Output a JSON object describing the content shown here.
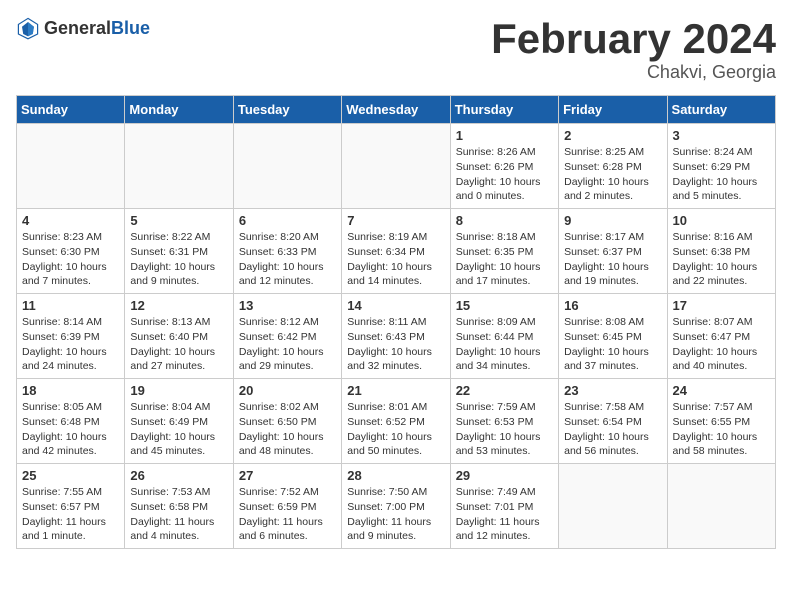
{
  "header": {
    "logo_general": "General",
    "logo_blue": "Blue",
    "month": "February 2024",
    "location": "Chakvi, Georgia"
  },
  "weekdays": [
    "Sunday",
    "Monday",
    "Tuesday",
    "Wednesday",
    "Thursday",
    "Friday",
    "Saturday"
  ],
  "weeks": [
    [
      {
        "day": "",
        "info": ""
      },
      {
        "day": "",
        "info": ""
      },
      {
        "day": "",
        "info": ""
      },
      {
        "day": "",
        "info": ""
      },
      {
        "day": "1",
        "info": "Sunrise: 8:26 AM\nSunset: 6:26 PM\nDaylight: 10 hours\nand 0 minutes."
      },
      {
        "day": "2",
        "info": "Sunrise: 8:25 AM\nSunset: 6:28 PM\nDaylight: 10 hours\nand 2 minutes."
      },
      {
        "day": "3",
        "info": "Sunrise: 8:24 AM\nSunset: 6:29 PM\nDaylight: 10 hours\nand 5 minutes."
      }
    ],
    [
      {
        "day": "4",
        "info": "Sunrise: 8:23 AM\nSunset: 6:30 PM\nDaylight: 10 hours\nand 7 minutes."
      },
      {
        "day": "5",
        "info": "Sunrise: 8:22 AM\nSunset: 6:31 PM\nDaylight: 10 hours\nand 9 minutes."
      },
      {
        "day": "6",
        "info": "Sunrise: 8:20 AM\nSunset: 6:33 PM\nDaylight: 10 hours\nand 12 minutes."
      },
      {
        "day": "7",
        "info": "Sunrise: 8:19 AM\nSunset: 6:34 PM\nDaylight: 10 hours\nand 14 minutes."
      },
      {
        "day": "8",
        "info": "Sunrise: 8:18 AM\nSunset: 6:35 PM\nDaylight: 10 hours\nand 17 minutes."
      },
      {
        "day": "9",
        "info": "Sunrise: 8:17 AM\nSunset: 6:37 PM\nDaylight: 10 hours\nand 19 minutes."
      },
      {
        "day": "10",
        "info": "Sunrise: 8:16 AM\nSunset: 6:38 PM\nDaylight: 10 hours\nand 22 minutes."
      }
    ],
    [
      {
        "day": "11",
        "info": "Sunrise: 8:14 AM\nSunset: 6:39 PM\nDaylight: 10 hours\nand 24 minutes."
      },
      {
        "day": "12",
        "info": "Sunrise: 8:13 AM\nSunset: 6:40 PM\nDaylight: 10 hours\nand 27 minutes."
      },
      {
        "day": "13",
        "info": "Sunrise: 8:12 AM\nSunset: 6:42 PM\nDaylight: 10 hours\nand 29 minutes."
      },
      {
        "day": "14",
        "info": "Sunrise: 8:11 AM\nSunset: 6:43 PM\nDaylight: 10 hours\nand 32 minutes."
      },
      {
        "day": "15",
        "info": "Sunrise: 8:09 AM\nSunset: 6:44 PM\nDaylight: 10 hours\nand 34 minutes."
      },
      {
        "day": "16",
        "info": "Sunrise: 8:08 AM\nSunset: 6:45 PM\nDaylight: 10 hours\nand 37 minutes."
      },
      {
        "day": "17",
        "info": "Sunrise: 8:07 AM\nSunset: 6:47 PM\nDaylight: 10 hours\nand 40 minutes."
      }
    ],
    [
      {
        "day": "18",
        "info": "Sunrise: 8:05 AM\nSunset: 6:48 PM\nDaylight: 10 hours\nand 42 minutes."
      },
      {
        "day": "19",
        "info": "Sunrise: 8:04 AM\nSunset: 6:49 PM\nDaylight: 10 hours\nand 45 minutes."
      },
      {
        "day": "20",
        "info": "Sunrise: 8:02 AM\nSunset: 6:50 PM\nDaylight: 10 hours\nand 48 minutes."
      },
      {
        "day": "21",
        "info": "Sunrise: 8:01 AM\nSunset: 6:52 PM\nDaylight: 10 hours\nand 50 minutes."
      },
      {
        "day": "22",
        "info": "Sunrise: 7:59 AM\nSunset: 6:53 PM\nDaylight: 10 hours\nand 53 minutes."
      },
      {
        "day": "23",
        "info": "Sunrise: 7:58 AM\nSunset: 6:54 PM\nDaylight: 10 hours\nand 56 minutes."
      },
      {
        "day": "24",
        "info": "Sunrise: 7:57 AM\nSunset: 6:55 PM\nDaylight: 10 hours\nand 58 minutes."
      }
    ],
    [
      {
        "day": "25",
        "info": "Sunrise: 7:55 AM\nSunset: 6:57 PM\nDaylight: 11 hours\nand 1 minute."
      },
      {
        "day": "26",
        "info": "Sunrise: 7:53 AM\nSunset: 6:58 PM\nDaylight: 11 hours\nand 4 minutes."
      },
      {
        "day": "27",
        "info": "Sunrise: 7:52 AM\nSunset: 6:59 PM\nDaylight: 11 hours\nand 6 minutes."
      },
      {
        "day": "28",
        "info": "Sunrise: 7:50 AM\nSunset: 7:00 PM\nDaylight: 11 hours\nand 9 minutes."
      },
      {
        "day": "29",
        "info": "Sunrise: 7:49 AM\nSunset: 7:01 PM\nDaylight: 11 hours\nand 12 minutes."
      },
      {
        "day": "",
        "info": ""
      },
      {
        "day": "",
        "info": ""
      }
    ]
  ]
}
